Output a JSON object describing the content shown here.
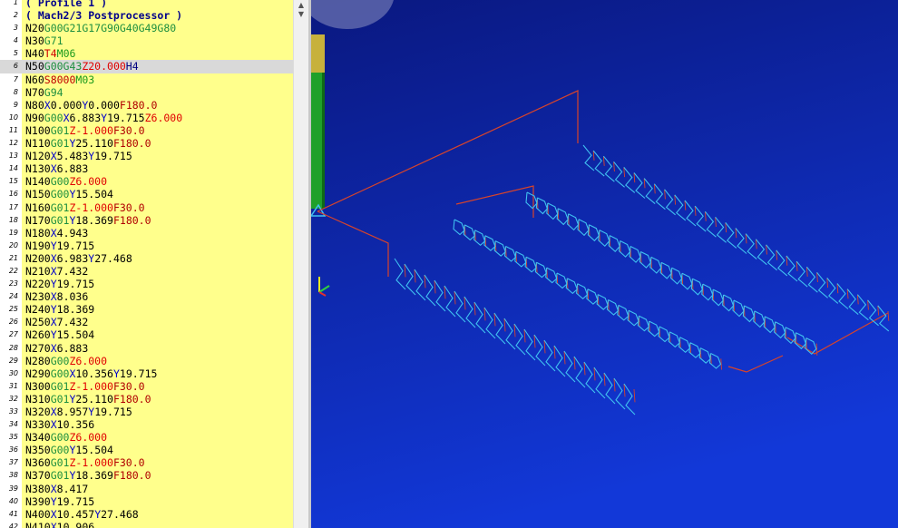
{
  "editor": {
    "lines": [
      [
        [
          "c-comment",
          "( Profile 1 )"
        ]
      ],
      [
        [
          "c-comment",
          "( Mach2/3 Postprocessor )"
        ]
      ],
      [
        [
          "t",
          "N20"
        ],
        [
          "c-g",
          "G00G21G17G90G40G49G80"
        ]
      ],
      [
        [
          "t",
          "N30"
        ],
        [
          "c-g",
          "G71"
        ]
      ],
      [
        [
          "t",
          "N40"
        ],
        [
          "c-t",
          "T4"
        ],
        [
          "c-m",
          "M06"
        ]
      ],
      [
        [
          "t",
          "N50"
        ],
        [
          "c-g",
          "G00G43"
        ],
        [
          "c-z",
          "Z20.000"
        ],
        [
          "c-h",
          "H4"
        ]
      ],
      [
        [
          "t",
          "N60"
        ],
        [
          "c-s",
          "S8000"
        ],
        [
          "c-m",
          "M03"
        ]
      ],
      [
        [
          "t",
          "N70"
        ],
        [
          "c-g",
          "G94"
        ]
      ],
      [
        [
          "t",
          "N80"
        ],
        [
          "c-x",
          "X"
        ],
        [
          "t",
          "0.000"
        ],
        [
          "c-x",
          "Y"
        ],
        [
          "t",
          "0.000"
        ],
        [
          "c-f",
          "F180.0"
        ]
      ],
      [
        [
          "t",
          "N90"
        ],
        [
          "c-g",
          "G00"
        ],
        [
          "c-x",
          "X"
        ],
        [
          "t",
          "6.883"
        ],
        [
          "c-x",
          "Y"
        ],
        [
          "t",
          "19.715"
        ],
        [
          "c-z",
          "Z6.000"
        ]
      ],
      [
        [
          "t",
          "N100"
        ],
        [
          "c-g",
          "G01"
        ],
        [
          "c-z",
          "Z-1.000"
        ],
        [
          "c-f",
          "F30.0"
        ]
      ],
      [
        [
          "t",
          "N110"
        ],
        [
          "c-g",
          "G01"
        ],
        [
          "c-x",
          "Y"
        ],
        [
          "t",
          "25.110"
        ],
        [
          "c-f",
          "F180.0"
        ]
      ],
      [
        [
          "t",
          "N120"
        ],
        [
          "c-x",
          "X"
        ],
        [
          "t",
          "5.483"
        ],
        [
          "c-x",
          "Y"
        ],
        [
          "t",
          "19.715"
        ]
      ],
      [
        [
          "t",
          "N130"
        ],
        [
          "c-x",
          "X"
        ],
        [
          "t",
          "6.883"
        ]
      ],
      [
        [
          "t",
          "N140"
        ],
        [
          "c-g",
          "G00"
        ],
        [
          "c-z",
          "Z6.000"
        ]
      ],
      [
        [
          "t",
          "N150"
        ],
        [
          "c-g",
          "G00"
        ],
        [
          "c-x",
          "Y"
        ],
        [
          "t",
          "15.504"
        ]
      ],
      [
        [
          "t",
          "N160"
        ],
        [
          "c-g",
          "G01"
        ],
        [
          "c-z",
          "Z-1.000"
        ],
        [
          "c-f",
          "F30.0"
        ]
      ],
      [
        [
          "t",
          "N170"
        ],
        [
          "c-g",
          "G01"
        ],
        [
          "c-x",
          "Y"
        ],
        [
          "t",
          "18.369"
        ],
        [
          "c-f",
          "F180.0"
        ]
      ],
      [
        [
          "t",
          "N180"
        ],
        [
          "c-x",
          "X"
        ],
        [
          "t",
          "4.943"
        ]
      ],
      [
        [
          "t",
          "N190"
        ],
        [
          "c-x",
          "Y"
        ],
        [
          "t",
          "19.715"
        ]
      ],
      [
        [
          "t",
          "N200"
        ],
        [
          "c-x",
          "X"
        ],
        [
          "t",
          "6.983"
        ],
        [
          "c-x",
          "Y"
        ],
        [
          "t",
          "27.468"
        ]
      ],
      [
        [
          "t",
          "N210"
        ],
        [
          "c-x",
          "X"
        ],
        [
          "t",
          "7.432"
        ]
      ],
      [
        [
          "t",
          "N220"
        ],
        [
          "c-x",
          "Y"
        ],
        [
          "t",
          "19.715"
        ]
      ],
      [
        [
          "t",
          "N230"
        ],
        [
          "c-x",
          "X"
        ],
        [
          "t",
          "8.036"
        ]
      ],
      [
        [
          "t",
          "N240"
        ],
        [
          "c-x",
          "Y"
        ],
        [
          "t",
          "18.369"
        ]
      ],
      [
        [
          "t",
          "N250"
        ],
        [
          "c-x",
          "X"
        ],
        [
          "t",
          "7.432"
        ]
      ],
      [
        [
          "t",
          "N260"
        ],
        [
          "c-x",
          "Y"
        ],
        [
          "t",
          "15.504"
        ]
      ],
      [
        [
          "t",
          "N270"
        ],
        [
          "c-x",
          "X"
        ],
        [
          "t",
          "6.883"
        ]
      ],
      [
        [
          "t",
          "N280"
        ],
        [
          "c-g",
          "G00"
        ],
        [
          "c-z",
          "Z6.000"
        ]
      ],
      [
        [
          "t",
          "N290"
        ],
        [
          "c-g",
          "G00"
        ],
        [
          "c-x",
          "X"
        ],
        [
          "t",
          "10.356"
        ],
        [
          "c-x",
          "Y"
        ],
        [
          "t",
          "19.715"
        ]
      ],
      [
        [
          "t",
          "N300"
        ],
        [
          "c-g",
          "G01"
        ],
        [
          "c-z",
          "Z-1.000"
        ],
        [
          "c-f",
          "F30.0"
        ]
      ],
      [
        [
          "t",
          "N310"
        ],
        [
          "c-g",
          "G01"
        ],
        [
          "c-x",
          "Y"
        ],
        [
          "t",
          "25.110"
        ],
        [
          "c-f",
          "F180.0"
        ]
      ],
      [
        [
          "t",
          "N320"
        ],
        [
          "c-x",
          "X"
        ],
        [
          "t",
          "8.957"
        ],
        [
          "c-x",
          "Y"
        ],
        [
          "t",
          "19.715"
        ]
      ],
      [
        [
          "t",
          "N330"
        ],
        [
          "c-x",
          "X"
        ],
        [
          "t",
          "10.356"
        ]
      ],
      [
        [
          "t",
          "N340"
        ],
        [
          "c-g",
          "G00"
        ],
        [
          "c-z",
          "Z6.000"
        ]
      ],
      [
        [
          "t",
          "N350"
        ],
        [
          "c-g",
          "G00"
        ],
        [
          "c-x",
          "Y"
        ],
        [
          "t",
          "15.504"
        ]
      ],
      [
        [
          "t",
          "N360"
        ],
        [
          "c-g",
          "G01"
        ],
        [
          "c-z",
          "Z-1.000"
        ],
        [
          "c-f",
          "F30.0"
        ]
      ],
      [
        [
          "t",
          "N370"
        ],
        [
          "c-g",
          "G01"
        ],
        [
          "c-x",
          "Y"
        ],
        [
          "t",
          "18.369"
        ],
        [
          "c-f",
          "F180.0"
        ]
      ],
      [
        [
          "t",
          "N380"
        ],
        [
          "c-x",
          "X"
        ],
        [
          "t",
          "8.417"
        ]
      ],
      [
        [
          "t",
          "N390"
        ],
        [
          "c-x",
          "Y"
        ],
        [
          "t",
          "19.715"
        ]
      ],
      [
        [
          "t",
          "N400"
        ],
        [
          "c-x",
          "X"
        ],
        [
          "t",
          "10.457"
        ],
        [
          "c-x",
          "Y"
        ],
        [
          "t",
          "27.468"
        ]
      ],
      [
        [
          "t",
          "N410"
        ],
        [
          "c-x",
          "X"
        ],
        [
          "t",
          "10.906"
        ]
      ]
    ],
    "highlighted_line": 6
  },
  "scrollbar": {
    "up_arrow_icon": "triangle-up-icon",
    "down_arrow_icon": "triangle-down-icon"
  },
  "viewport": {
    "background_top": "#0a1880",
    "background_bottom": "#1238d8",
    "rapid_move_color": "#d8442a",
    "cut_path_color": "#3fc0f0",
    "tool_body_color": "#1fa02a",
    "tool_tip_color": "#d8c84a",
    "axis_icon": "xyz-axis-triad-icon",
    "tool_icon": "cutter-tool-icon",
    "rows": [
      {
        "name": "row-1-upper",
        "count": 30
      },
      {
        "name": "row-2",
        "count": 28
      },
      {
        "name": "row-3",
        "count": 26
      },
      {
        "name": "row-4-lower",
        "count": 24
      }
    ]
  }
}
